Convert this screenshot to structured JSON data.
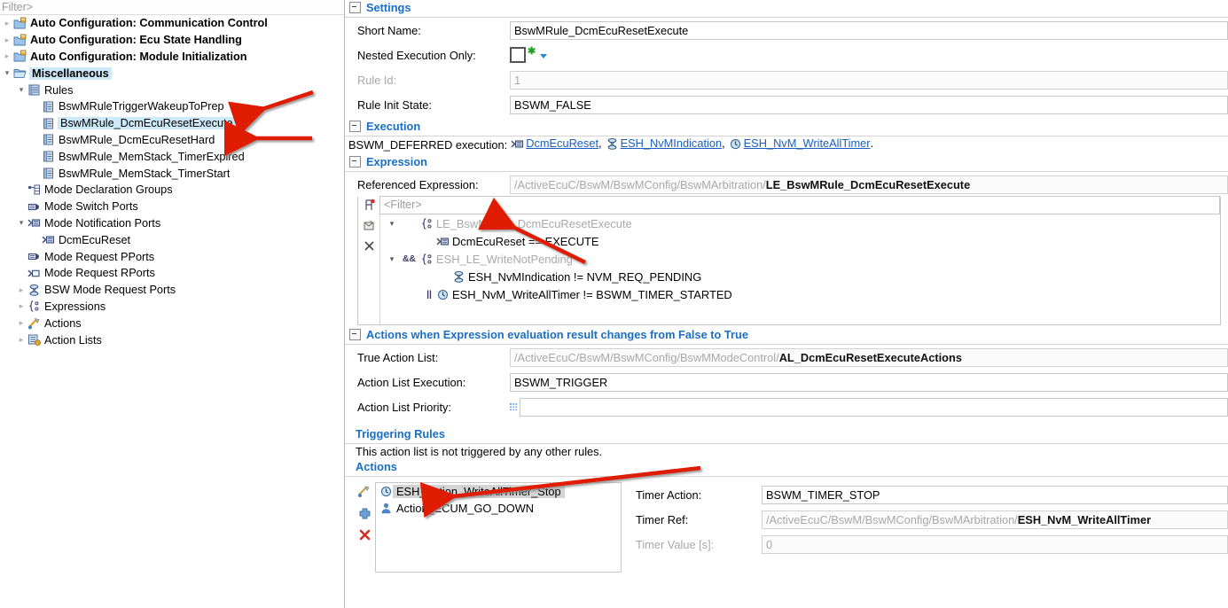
{
  "tree": {
    "filter_placeholder": "Filter>",
    "items": [
      {
        "label": "Auto Configuration: Communication Control",
        "indent": 0,
        "twist": "›",
        "icon": "folder-config-icon",
        "bold": true,
        "selected": false
      },
      {
        "label": "Auto Configuration: Ecu State Handling",
        "indent": 0,
        "twist": "›",
        "icon": "folder-config-icon",
        "bold": true,
        "selected": false
      },
      {
        "label": "Auto Configuration: Module Initialization",
        "indent": 0,
        "twist": "›",
        "icon": "folder-config-icon",
        "bold": true,
        "selected": false
      },
      {
        "label": "Miscellaneous",
        "indent": 0,
        "twist": "⌄",
        "icon": "folder-open-icon",
        "bold": true,
        "selected": true
      },
      {
        "label": "Rules",
        "indent": 1,
        "twist": "⌄",
        "icon": "rules-container-icon",
        "bold": false,
        "selected": false
      },
      {
        "label": "BswMRuleTriggerWakeupToPrep",
        "indent": 2,
        "twist": "",
        "icon": "rule-icon",
        "bold": false,
        "selected": false
      },
      {
        "label": "BswMRule_DcmEcuResetExecute",
        "indent": 2,
        "twist": "",
        "icon": "rule-icon",
        "bold": false,
        "selected": true
      },
      {
        "label": "BswMRule_DcmEcuResetHard",
        "indent": 2,
        "twist": "",
        "icon": "rule-icon",
        "bold": false,
        "selected": false
      },
      {
        "label": "BswMRule_MemStack_TimerExpired",
        "indent": 2,
        "twist": "",
        "icon": "rule-icon",
        "bold": false,
        "selected": false
      },
      {
        "label": "BswMRule_MemStack_TimerStart",
        "indent": 2,
        "twist": "",
        "icon": "rule-icon",
        "bold": false,
        "selected": false
      },
      {
        "label": "Mode Declaration Groups",
        "indent": 1,
        "twist": "",
        "icon": "mode-decl-group-icon",
        "bold": false,
        "selected": false
      },
      {
        "label": "Mode Switch Ports",
        "indent": 1,
        "twist": "",
        "icon": "mode-switch-port-icon",
        "bold": false,
        "selected": false
      },
      {
        "label": "Mode Notification Ports",
        "indent": 1,
        "twist": "⌄",
        "icon": "mode-notification-port-icon",
        "bold": false,
        "selected": false
      },
      {
        "label": "DcmEcuReset",
        "indent": 2,
        "twist": "",
        "icon": "mode-notification-port-icon",
        "bold": false,
        "selected": false
      },
      {
        "label": "Mode Request PPorts",
        "indent": 1,
        "twist": "",
        "icon": "mode-request-pport-icon",
        "bold": false,
        "selected": false
      },
      {
        "label": "Mode Request RPorts",
        "indent": 1,
        "twist": "",
        "icon": "mode-request-rport-icon",
        "bold": false,
        "selected": false
      },
      {
        "label": "BSW Mode Request Ports",
        "indent": 1,
        "twist": "›",
        "icon": "bsw-mode-request-port-icon",
        "bold": false,
        "selected": false
      },
      {
        "label": "Expressions",
        "indent": 1,
        "twist": "›",
        "icon": "expression-icon",
        "bold": false,
        "selected": false
      },
      {
        "label": "Actions",
        "indent": 1,
        "twist": "›",
        "icon": "action-icon",
        "bold": false,
        "selected": false
      },
      {
        "label": "Action Lists",
        "indent": 1,
        "twist": "›",
        "icon": "action-list-icon",
        "bold": false,
        "selected": false
      }
    ]
  },
  "settings": {
    "title": "Settings",
    "short_name_label": "Short Name:",
    "short_name_value": "BswMRule_DcmEcuResetExecute",
    "nested_execution_label": "Nested Execution Only:",
    "nested_execution_checked": false,
    "rule_id_label": "Rule Id:",
    "rule_id_value": "1",
    "rule_init_state_label": "Rule Init State:",
    "rule_init_state_value": "BSWM_FALSE"
  },
  "execution": {
    "title": "Execution",
    "prefix": "BSWM_DEFERRED execution:",
    "links": [
      {
        "text": "DcmEcuReset",
        "icon": "mode-notification-port-icon",
        "sep": ","
      },
      {
        "text": "ESH_NvMIndication",
        "icon": "bsw-mode-request-port-icon",
        "sep": ","
      },
      {
        "text": "ESH_NvM_WriteAllTimer",
        "icon": "timer-icon",
        "sep": "."
      }
    ]
  },
  "expression": {
    "title": "Expression",
    "referenced_label": "Referenced Expression:",
    "referenced_path": "/ActiveEcuC/BswM/BswMConfig/BswMArbitration/",
    "referenced_name": "LE_BswMRule_DcmEcuResetExecute",
    "filter_placeholder": "<Filter>",
    "tools": [
      "expression-filter-icon",
      "edit-expression-icon",
      "remove-expression-icon"
    ],
    "nodes": [
      {
        "twist": "⌄",
        "op": "",
        "icon": "expression-icon",
        "text": "LE_BswMRule_DcmEcuResetExecute",
        "indent": 0,
        "gray": true
      },
      {
        "twist": "",
        "op": "",
        "icon": "mode-notification-port-icon",
        "text": "DcmEcuReset == EXECUTE",
        "indent": 1,
        "gray": false
      },
      {
        "twist": "⌄",
        "op": "&&",
        "icon": "expression-icon",
        "text": "ESH_LE_WriteNotPending",
        "indent": 0,
        "gray": true
      },
      {
        "twist": "",
        "op": "",
        "icon": "bsw-mode-request-port-icon",
        "text": "ESH_NvMIndication != NVM_REQ_PENDING",
        "indent": 2,
        "gray": false
      },
      {
        "twist": "",
        "op": "||",
        "icon": "timer-icon",
        "text": "ESH_NvM_WriteAllTimer != BSWM_TIMER_STARTED",
        "indent": 1,
        "gray": false
      }
    ]
  },
  "false_to_true": {
    "title": "Actions when Expression evaluation result changes from False to True",
    "true_action_list_label": "True Action List:",
    "true_action_list_path": "/ActiveEcuC/BswM/BswMConfig/BswMModeControl/",
    "true_action_list_name": "AL_DcmEcuResetExecuteActions",
    "action_list_execution_label": "Action List Execution:",
    "action_list_execution_value": "BSWM_TRIGGER",
    "action_list_priority_label": "Action List Priority:",
    "action_list_priority_value": ""
  },
  "triggering_rules": {
    "title": "Triggering Rules",
    "message": "This action list is not triggered by any other rules."
  },
  "actions": {
    "title": "Actions",
    "tools": [
      "edit-action-icon",
      "add-action-icon",
      "delete-action-icon"
    ],
    "items": [
      {
        "label": "ESH_Action_WriteAllTimer_Stop",
        "icon": "timer-icon",
        "selected": true
      },
      {
        "label": "Action_ECUM_GO_DOWN",
        "icon": "ecum-action-icon",
        "selected": false
      }
    ],
    "detail": {
      "timer_action_label": "Timer Action:",
      "timer_action_value": "BSWM_TIMER_STOP",
      "timer_ref_label": "Timer Ref:",
      "timer_ref_path": "/ActiveEcuC/BswM/BswMConfig/BswMArbitration/",
      "timer_ref_name": "ESH_NvM_WriteAllTimer",
      "timer_value_label": "Timer Value [s]:",
      "timer_value_value": "0"
    }
  },
  "annotations": {
    "arrow_color": "#e01b00",
    "arrows": [
      {
        "name": "arrow-to-selected-rule"
      },
      {
        "name": "arrow-to-hard-rule"
      },
      {
        "name": "arrow-to-expression-filter"
      },
      {
        "name": "arrow-to-actions-heading"
      }
    ]
  }
}
